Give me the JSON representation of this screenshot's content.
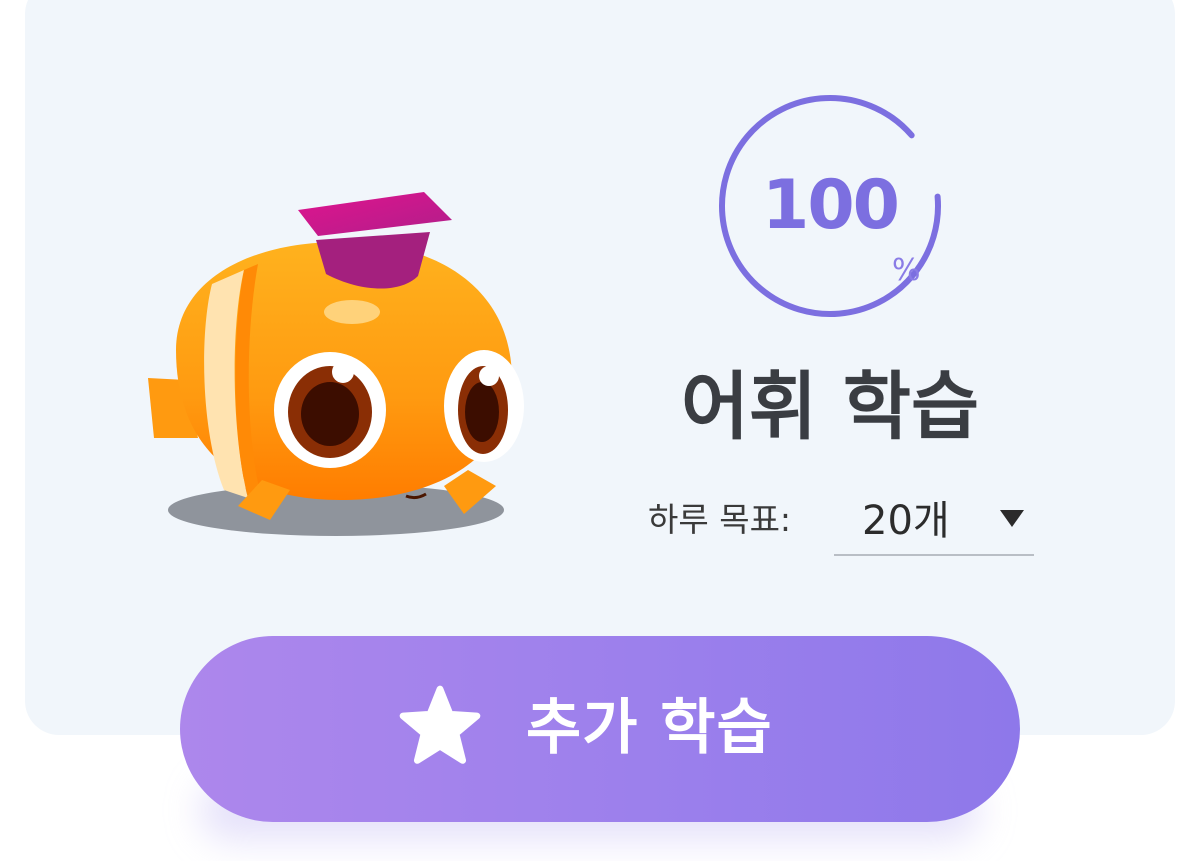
{
  "progress": {
    "value": "100",
    "unit": "%",
    "fraction": 0.9,
    "color": "#7c6fe0"
  },
  "study": {
    "title": "어휘 학습"
  },
  "daily_goal": {
    "label": "하루 목표:",
    "value": "20개",
    "dropdown_icon": "caret-down-icon"
  },
  "cta": {
    "label": "추가 학습",
    "icon": "star-icon",
    "color_start": "#ad87ec",
    "color_end": "#8e78ea"
  },
  "mascot": {
    "icon": "fish-mascot-with-graduation-cap"
  }
}
